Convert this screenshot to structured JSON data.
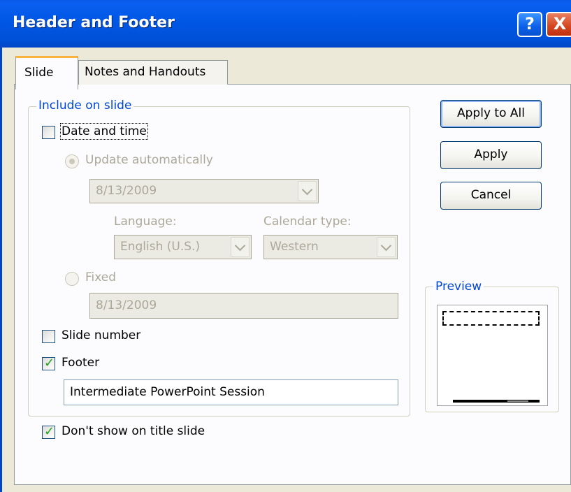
{
  "window": {
    "title": "Header and Footer",
    "help_glyph": "?",
    "close_glyph": "X"
  },
  "tabs": [
    {
      "label": "Slide",
      "active": true
    },
    {
      "label": "Notes and Handouts",
      "active": false
    }
  ],
  "include_group": {
    "legend": "Include on slide",
    "date_time": {
      "label": "Date and time",
      "checked": false
    },
    "update_automatically": {
      "label": "Update automatically",
      "selected": true,
      "enabled": false
    },
    "date_combo": {
      "value": "8/13/2009"
    },
    "language": {
      "label": "Language:",
      "value": "English (U.S.)"
    },
    "calendar_type": {
      "label": "Calendar type:",
      "value": "Western"
    },
    "fixed": {
      "label": "Fixed",
      "selected": false,
      "enabled": false
    },
    "fixed_value": "8/13/2009",
    "slide_number": {
      "label": "Slide number",
      "checked": false
    },
    "footer": {
      "label": "Footer",
      "checked": true,
      "value": "Intermediate PowerPoint Session"
    }
  },
  "dont_show_title": {
    "label": "Don't show on title slide",
    "checked": true
  },
  "buttons": {
    "apply_all": "Apply to All",
    "apply": "Apply",
    "cancel": "Cancel"
  },
  "preview": {
    "legend": "Preview"
  },
  "colors": {
    "title_bar": "#0058e6",
    "legend_text": "#0046d5",
    "check_mark": "#21a121",
    "dialog_bg": "#ece9d8"
  },
  "icons": {
    "help": "help-icon",
    "close": "close-icon",
    "check": "checkmark-icon",
    "dropdown": "chevron-down-icon"
  }
}
